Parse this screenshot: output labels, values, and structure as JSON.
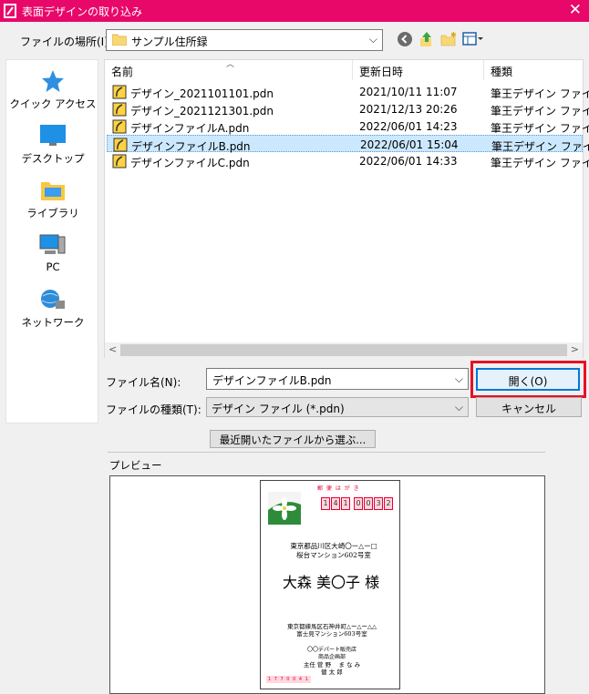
{
  "window": {
    "title": "表面デザインの取り込み",
    "close": "✕"
  },
  "lookin": {
    "label": "ファイルの場所(I):",
    "value": "サンプル住所録"
  },
  "places": [
    {
      "label": "クイック アクセス",
      "icon": "star-icon"
    },
    {
      "label": "デスクトップ",
      "icon": "desktop-icon"
    },
    {
      "label": "ライブラリ",
      "icon": "library-icon"
    },
    {
      "label": "PC",
      "icon": "pc-icon"
    },
    {
      "label": "ネットワーク",
      "icon": "network-icon"
    }
  ],
  "columns": {
    "name": "名前",
    "modified": "更新日時",
    "type": "種類"
  },
  "files": [
    {
      "name": "デザイン_2021101101.pdn",
      "modified": "2021/10/11 11:07",
      "type": "筆王デザイン ファイル"
    },
    {
      "name": "デザイン_2021121301.pdn",
      "modified": "2021/12/13 20:26",
      "type": "筆王デザイン ファイル"
    },
    {
      "name": "デザインファイルA.pdn",
      "modified": "2022/06/01 14:23",
      "type": "筆王デザイン ファイル"
    },
    {
      "name": "デザインファイルB.pdn",
      "modified": "2022/06/01 15:04",
      "type": "筆王デザイン ファイル"
    },
    {
      "name": "デザインファイルC.pdn",
      "modified": "2022/06/01 14:33",
      "type": "筆王デザイン ファイル"
    }
  ],
  "filename": {
    "label": "ファイル名(N):",
    "value": "デザインファイルB.pdn"
  },
  "filetype": {
    "label": "ファイルの種類(T):",
    "value": "デザイン ファイル (*.pdn)"
  },
  "buttons": {
    "open": "開く(O)",
    "cancel": "キャンセル",
    "recent": "最近開いたファイルから選ぶ..."
  },
  "preview": {
    "label": "プレビュー",
    "postcard": {
      "yubin": "郵 便 は が き",
      "zip": [
        "1",
        "4",
        "1",
        "0",
        "0",
        "3",
        "2"
      ],
      "addr1": "東京都品川区大崎〇ー△ー□",
      "addr2": "桜台マンション602号室",
      "name": "大森 美〇子 様",
      "sender_addr1": "東京都練馬区石神井町△ー△ー△△",
      "sender_addr2": "富士見マンション603号室",
      "sender_co": "〇〇デパート販売店",
      "sender_dept": "商品企画部",
      "sender_name1": "主任 菅 野　 ま な み",
      "sender_name2": "健 太 郎",
      "sender_zip": "1 7 7 0 0 4 1"
    }
  }
}
